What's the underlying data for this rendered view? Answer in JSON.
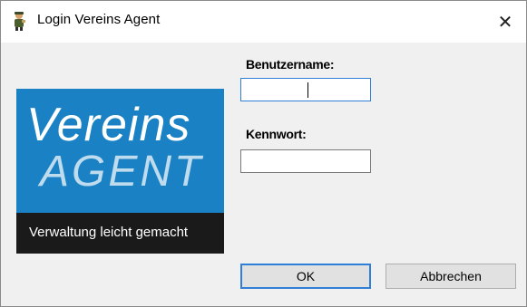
{
  "window": {
    "title": "Login Vereins Agent",
    "close_glyph": "✕",
    "app_icon": "mascot-icon"
  },
  "logo": {
    "line1": "Vereins",
    "line2": "AGENT",
    "tagline": "Verwaltung leicht gemacht",
    "colors": {
      "blue": "#1a82c4",
      "dark": "#1a1a1a"
    }
  },
  "form": {
    "username_label": "Benutzername:",
    "username_value": "",
    "password_label": "Kennwort:",
    "password_value": ""
  },
  "buttons": {
    "ok_label": "OK",
    "cancel_label": "Abbrechen"
  }
}
